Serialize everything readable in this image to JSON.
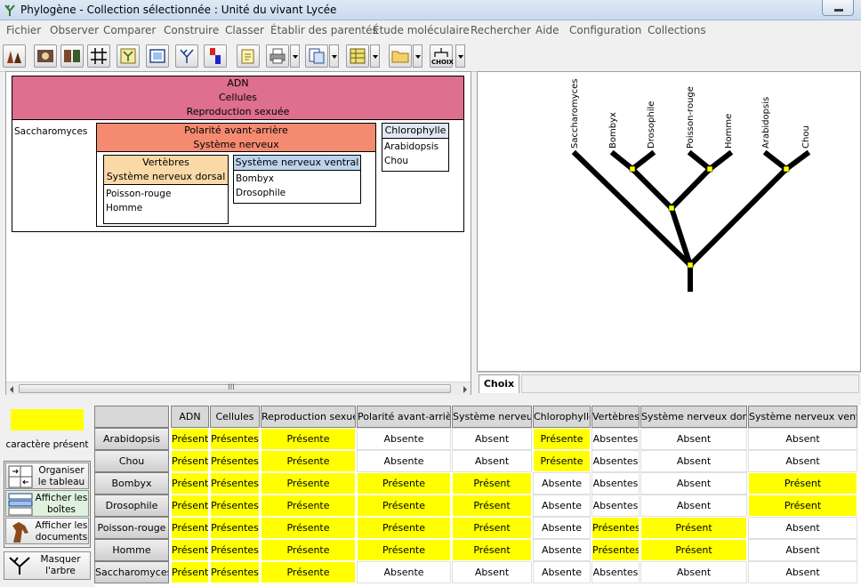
{
  "window": {
    "title": "Phylogène - Collection sélectionnée : Unité du vivant Lycée",
    "app_icon": "phylogene-tree-icon"
  },
  "menu": [
    "Fichier",
    "Observer",
    "Comparer",
    "Construire",
    "Classer",
    "Établir des parentés",
    "Étude moléculaire",
    "Rechercher",
    "Aide",
    "Configuration",
    "Collections"
  ],
  "toolbar": {
    "choix_label": "CHOIX",
    "icons": [
      "organisms-icon",
      "observe-icon",
      "compare-icon",
      "grid-icon",
      "tree-build-icon",
      "window-icon",
      "tree-icon",
      "molecule-icon",
      "notepad-icon",
      "print-icon",
      "export-icon",
      "table-icon",
      "folder-icon",
      "choix-icon"
    ]
  },
  "boxes": {
    "outer": {
      "labels": [
        "ADN",
        "Cellules",
        "Reproduction sexuée"
      ],
      "color": "#de6f8e"
    },
    "loose": [
      "Saccharomyces"
    ],
    "polarite": {
      "labels": [
        "Polarité avant-arrière",
        "Système nerveux"
      ],
      "color": "#f48a70"
    },
    "vertebres": {
      "labels": [
        "Vertèbres",
        "Système nerveux dorsal"
      ],
      "color": "#fbd9a6",
      "members": [
        "Poisson-rouge",
        "Homme"
      ]
    },
    "ventral": {
      "labels": [
        "Système nerveux ventral"
      ],
      "color": "#bdd3ec",
      "members": [
        "Bombyx",
        "Drosophile"
      ]
    },
    "chlorophylle": {
      "labels": [
        "Chlorophylle"
      ],
      "color": "#e0e7f3",
      "members": [
        "Arabidopsis",
        "Chou"
      ]
    }
  },
  "tree": {
    "leaves": [
      "Saccharomyces",
      "Bombyx",
      "Drosophile",
      "Poisson-rouge",
      "Homme",
      "Arabidopsis",
      "Chou"
    ],
    "node_color": "#ffff00"
  },
  "choix_tab": "Choix",
  "legend": {
    "color": "#ffff00",
    "text": "caractère présent"
  },
  "side_buttons": [
    {
      "label": "Organiser le tableau",
      "icon": "organize-icon"
    },
    {
      "label": "Afficher les boîtes",
      "icon": "boxes-icon"
    },
    {
      "label": "Afficher les documents",
      "icon": "horse-icon"
    },
    {
      "label": "Masquer l'arbre",
      "icon": "tree-hide-icon"
    }
  ],
  "table": {
    "columns": [
      "ADN",
      "Cellules",
      "Reproduction sexuée",
      "Polarité avant-arrière",
      "Système nerveux",
      "Chlorophylle",
      "Vertèbres",
      "Système nerveux dorsal",
      "Système nerveux ventral"
    ],
    "rows": [
      {
        "name": "Arabidopsis",
        "values": [
          "Présent",
          "Présentes",
          "Présente",
          "Absente",
          "Absent",
          "Présente",
          "Absentes",
          "Absent",
          "Absent"
        ]
      },
      {
        "name": "Chou",
        "values": [
          "Présent",
          "Présentes",
          "Présente",
          "Absente",
          "Absent",
          "Présente",
          "Absentes",
          "Absent",
          "Absent"
        ]
      },
      {
        "name": "Bombyx",
        "values": [
          "Présent",
          "Présentes",
          "Présente",
          "Présente",
          "Présent",
          "Absente",
          "Absentes",
          "Absent",
          "Présent"
        ]
      },
      {
        "name": "Drosophile",
        "values": [
          "Présent",
          "Présentes",
          "Présente",
          "Présente",
          "Présent",
          "Absente",
          "Absentes",
          "Absent",
          "Présent"
        ]
      },
      {
        "name": "Poisson-rouge",
        "values": [
          "Présent",
          "Présentes",
          "Présente",
          "Présente",
          "Présent",
          "Absente",
          "Présentes",
          "Présent",
          "Absent"
        ]
      },
      {
        "name": "Homme",
        "values": [
          "Présent",
          "Présentes",
          "Présente",
          "Présente",
          "Présent",
          "Absente",
          "Présentes",
          "Présent",
          "Absent"
        ]
      },
      {
        "name": "Saccharomyces",
        "values": [
          "Présent",
          "Présentes",
          "Présente",
          "Absente",
          "Absent",
          "Absente",
          "Absentes",
          "Absent",
          "Absent"
        ]
      }
    ]
  }
}
